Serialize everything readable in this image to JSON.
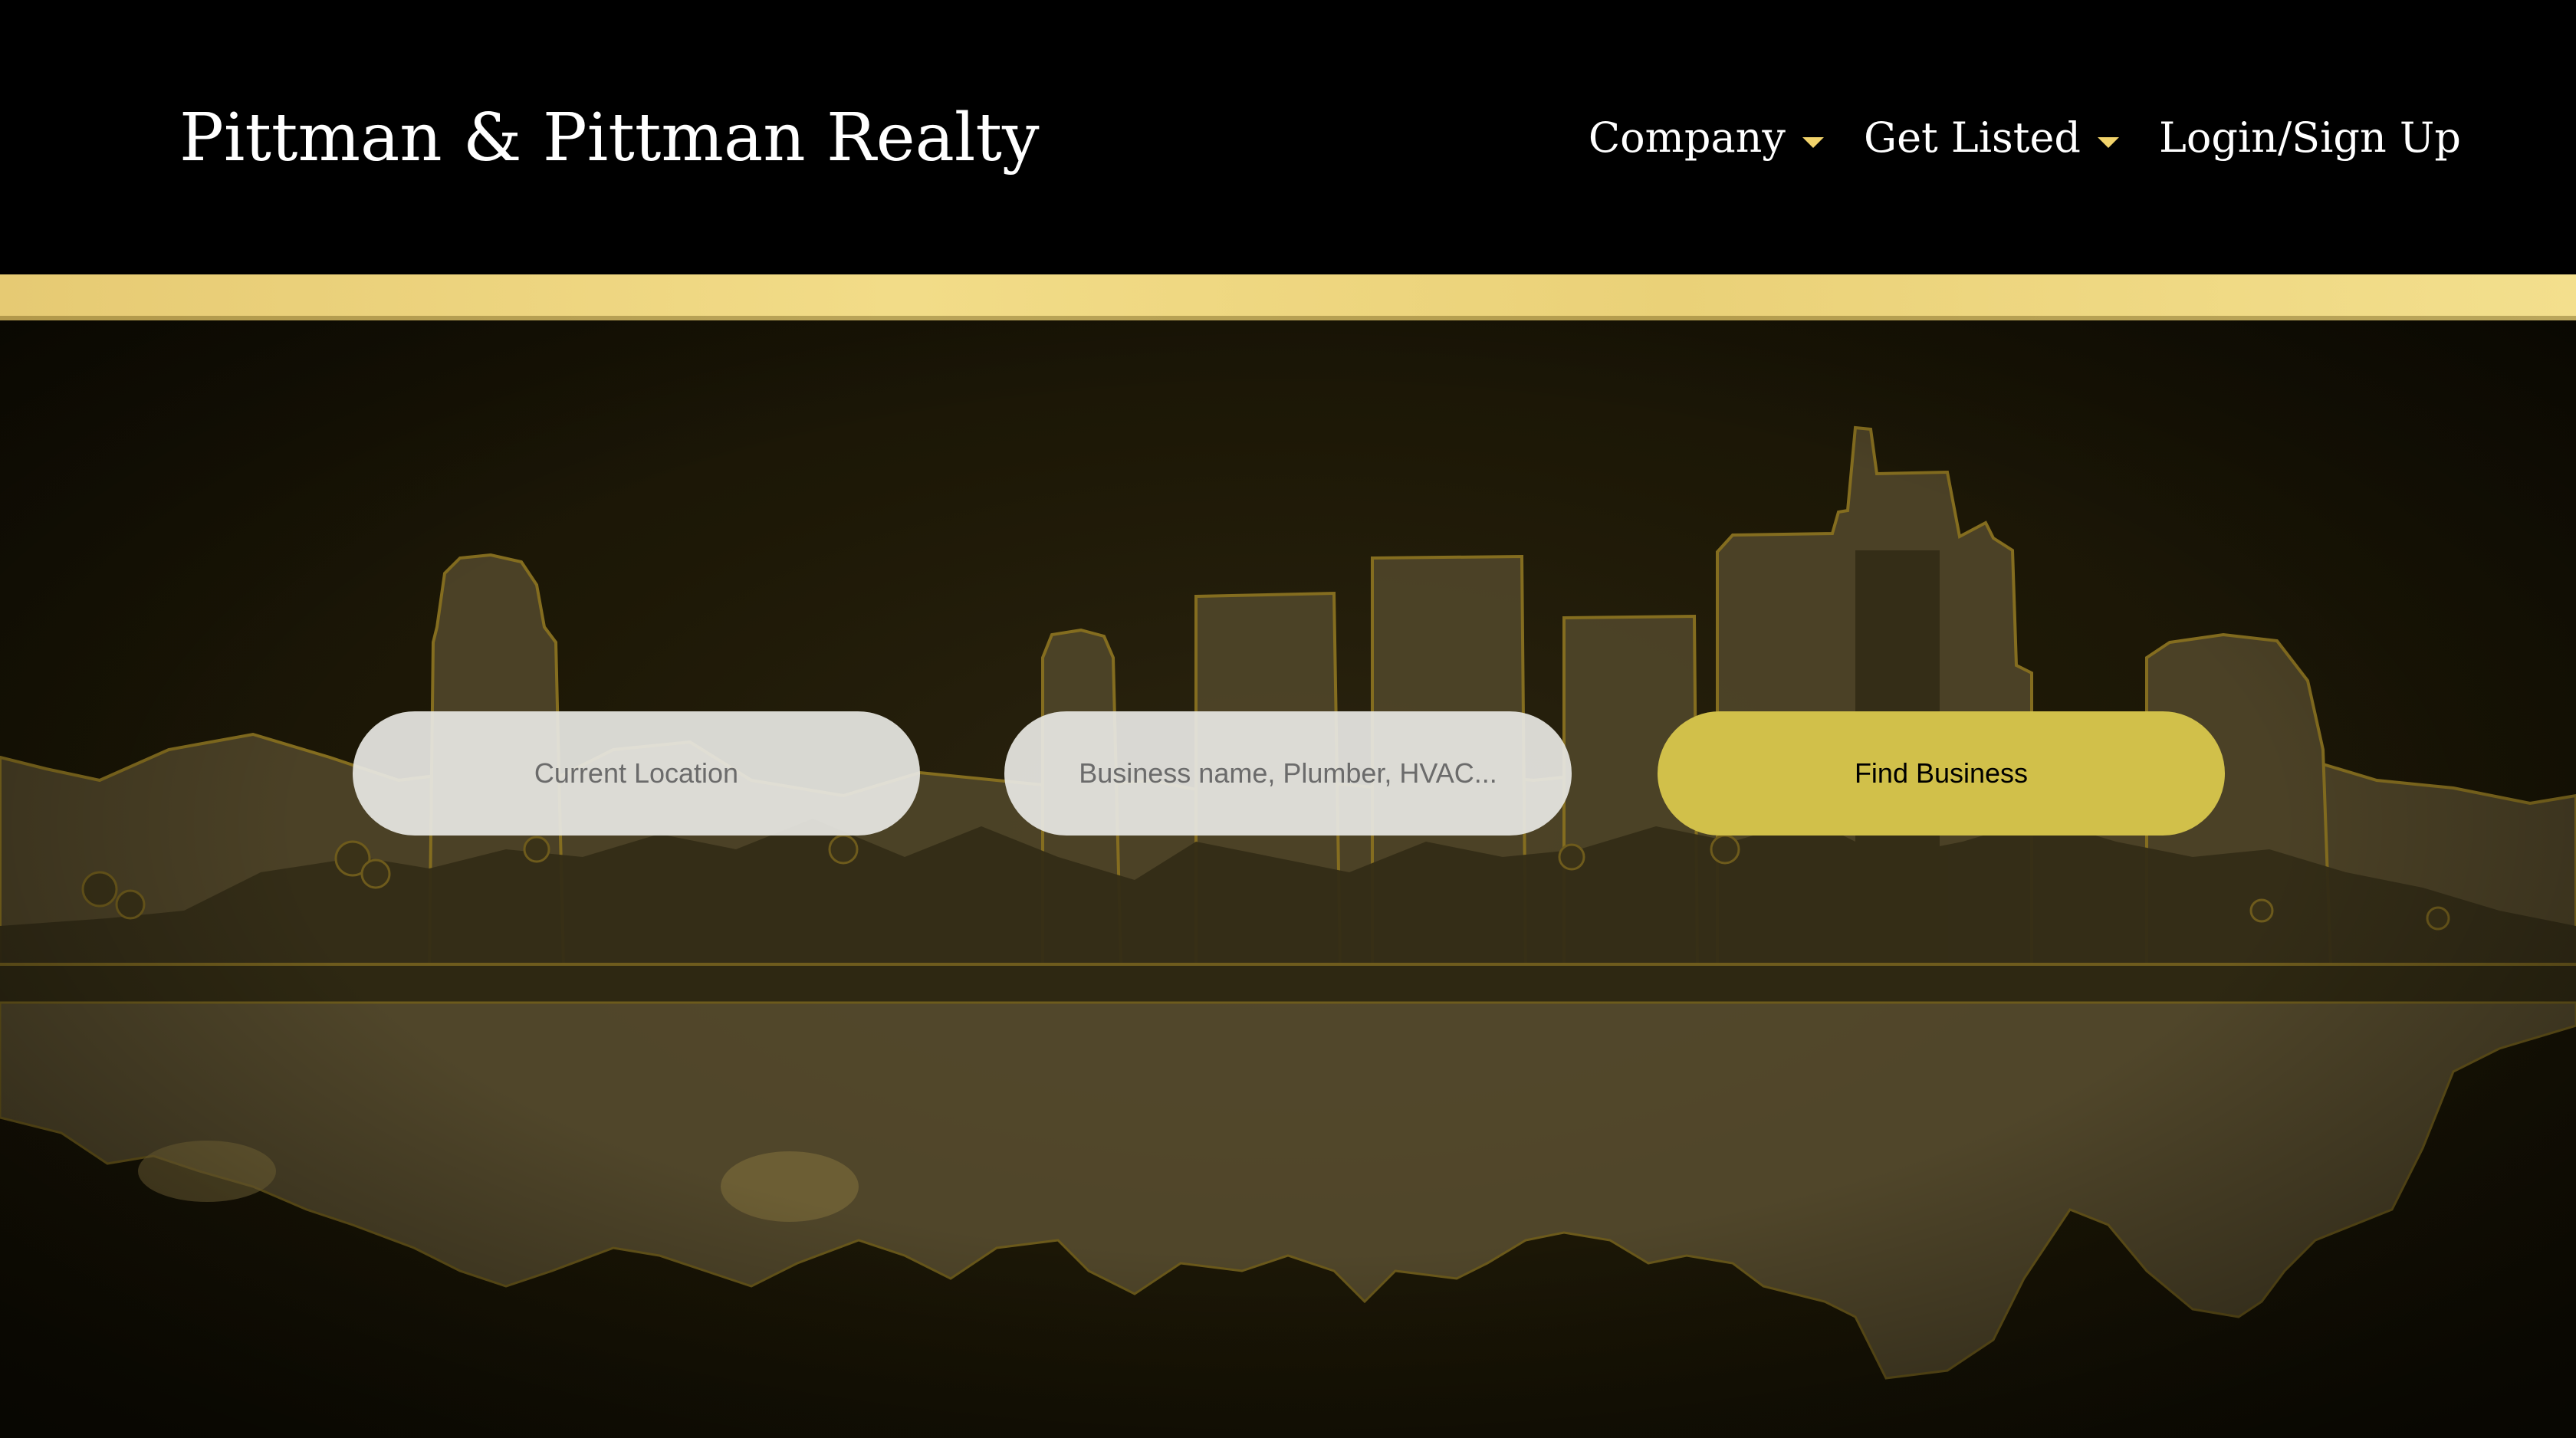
{
  "header": {
    "brand": "Pittman & Pittman Realty",
    "nav": [
      {
        "label": "Company",
        "has_dropdown": true
      },
      {
        "label": "Get Listed",
        "has_dropdown": true
      },
      {
        "label": "Login/Sign Up",
        "has_dropdown": false
      }
    ]
  },
  "search": {
    "location_placeholder": "Current Location",
    "business_placeholder": "Business name, Plumber, HVAC...",
    "submit_label": "Find Business"
  },
  "colors": {
    "header_bg": "#000000",
    "gold_band": "#ecd47d",
    "hero_bg": "#1d1806",
    "button_bg": "#d1c04a",
    "caret": "#f2d36b"
  },
  "icons": {
    "dropdown_caret": "chevron-down-icon",
    "skyline": "city-skyline-illustration"
  }
}
